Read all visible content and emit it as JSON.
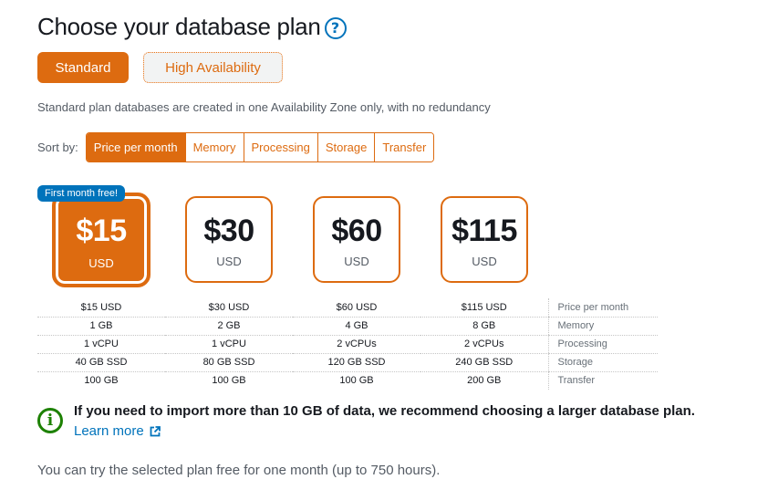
{
  "header": {
    "title": "Choose your database plan",
    "help_icon": "question-circle-icon",
    "help_glyph": "?"
  },
  "plan_toggle": {
    "options": [
      {
        "label": "Standard",
        "selected": true
      },
      {
        "label": "High Availability",
        "selected": false
      }
    ]
  },
  "plan_description": "Standard plan databases are created in one Availability Zone only, with no redundancy",
  "sort": {
    "label": "Sort by:",
    "options": [
      {
        "label": "Price per month",
        "selected": true
      },
      {
        "label": "Memory",
        "selected": false
      },
      {
        "label": "Processing",
        "selected": false
      },
      {
        "label": "Storage",
        "selected": false
      },
      {
        "label": "Transfer",
        "selected": false
      }
    ]
  },
  "badge": "First month free!",
  "plans": [
    {
      "price": "$15",
      "currency": "USD",
      "selected": true,
      "price_per_month": "$15 USD",
      "memory": "1 GB",
      "processing": "1 vCPU",
      "storage": "40 GB SSD",
      "transfer": "100 GB"
    },
    {
      "price": "$30",
      "currency": "USD",
      "selected": false,
      "price_per_month": "$30 USD",
      "memory": "2 GB",
      "processing": "1 vCPU",
      "storage": "80 GB SSD",
      "transfer": "100 GB"
    },
    {
      "price": "$60",
      "currency": "USD",
      "selected": false,
      "price_per_month": "$60 USD",
      "memory": "4 GB",
      "processing": "2 vCPUs",
      "storage": "120 GB SSD",
      "transfer": "100 GB"
    },
    {
      "price": "$115",
      "currency": "USD",
      "selected": false,
      "price_per_month": "$115 USD",
      "memory": "8 GB",
      "processing": "2 vCPUs",
      "storage": "240 GB SSD",
      "transfer": "200 GB"
    }
  ],
  "spec_labels": {
    "price_per_month": "Price per month",
    "memory": "Memory",
    "processing": "Processing",
    "storage": "Storage",
    "transfer": "Transfer"
  },
  "notice": {
    "icon": "info-circle-icon",
    "icon_glyph": "i",
    "text": "If you need to import more than 10 GB of data, we recommend choosing a larger database plan.",
    "link_label": "Learn more",
    "link_icon": "external-link-icon"
  },
  "footer_note": "You can try the selected plan free for one month (up to 750 hours).",
  "colors": {
    "accent": "#dd6b10",
    "link": "#0073bb",
    "badge": "#0073bb",
    "info": "#1d8102",
    "text": "#16191f",
    "muted": "#545b64"
  }
}
